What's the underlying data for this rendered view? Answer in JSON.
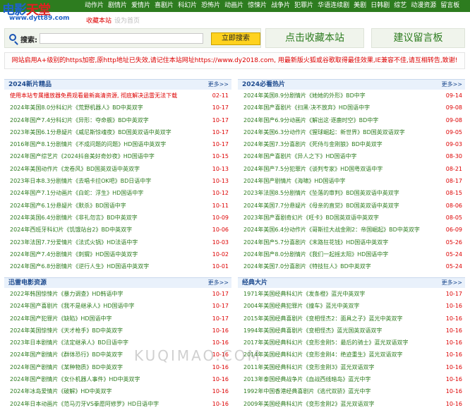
{
  "logo": {
    "main": "电影",
    "accent": "天堂",
    "domain": "www.dytt89.com"
  },
  "nav": [
    "动作片",
    "剧情片",
    "爱情片",
    "喜剧片",
    "科幻片",
    "恐怖片",
    "动画片",
    "惊悚片",
    "战争片",
    "犯罪片",
    "华语连续剧",
    "美剧",
    "日韩剧",
    "综艺",
    "动漫资源",
    "留言板"
  ],
  "subnav": {
    "favorite": "收藏本站",
    "home": "设为首页"
  },
  "search": {
    "label": "搜索:",
    "placeholder": "",
    "button": "立即搜索"
  },
  "buttons": {
    "bookmark": "点击收藏本站",
    "guestbook": "建议留言板"
  },
  "notice": "网站启用A+级别的https加密,原http地址已失效,请记住本站网址https://www.dy2018.com, 用最新版火狐或谷歌取得最佳效果,IE兼容不佳,请互相转告,致谢!",
  "panels": [
    {
      "title": "2024新片精品",
      "more": "更多>>",
      "rows": [
        {
          "name": "使用本站专属播放器免费观看最新高清资源, 彻底解决迅雷无法下载",
          "date": "02-11",
          "hot": true
        },
        {
          "name": "2024年美国8.0分科幻片《荒野机器人》BD中英双字",
          "date": "10-17"
        },
        {
          "name": "2024年国产7.4分科幻片《异形：夺命舰》BD中英双字",
          "date": "10-17"
        },
        {
          "name": "2023年美国6.1分悬疑片《威尼斯惊魂夜》BD国英双语中英双字",
          "date": "10-17"
        },
        {
          "name": "2016年国产8.1分剧情片《不成问题的问题》HD国语中英双字",
          "date": "10-17"
        },
        {
          "name": "2024年国产综艺片《2024抖音美好奇妙夜》HD国语中字",
          "date": "10-15"
        },
        {
          "name": "2024年美国动作片《龙卷风》BD国英双语中英双字",
          "date": "10-13"
        },
        {
          "name": "2023年日本8.3分剧情片《去唱卡拉OK吧》BD日语中字",
          "date": "10-13"
        },
        {
          "name": "2024年国产7.1分动画片《白蛇：浮生》HD国语中字",
          "date": "10-12"
        },
        {
          "name": "2024年国产6.1分悬疑片《默杀》BD国语中字",
          "date": "10-11"
        },
        {
          "name": "2024年英国6.4分剧情片《非礼勿言》BD中英双字",
          "date": "10-09"
        },
        {
          "name": "2024年西班牙科幻片《饥饿站台2》BD中英双字",
          "date": "10-06"
        },
        {
          "name": "2023年法国7.7分爱情片《法式火锅》HD法语中字",
          "date": "10-03"
        },
        {
          "name": "2024年国产7.4分剧情片《刺猬》HD国语中英双字",
          "date": "10-02"
        },
        {
          "name": "2024年国产6.8分剧情片《逆行人生》HD国语中英双字",
          "date": "10-01"
        }
      ]
    },
    {
      "title": "2024必看热片",
      "more": "更多>>",
      "rows": [
        {
          "name": "2024年美国8.9分剧情片《她她的外形》BD中字",
          "date": "09-14"
        },
        {
          "name": "2024年国产喜剧片《扫黑·决不放弃》HD国语中字",
          "date": "09-08"
        },
        {
          "name": "2024年国产6.9分动画片《解出这·逐鹿时空》BD中字",
          "date": "09-08"
        },
        {
          "name": "2024年美国6.3分动作片《猩球崛起：新世界》BD国英双语双字",
          "date": "09-05"
        },
        {
          "name": "2024年美国7.3分喜剧片《死侍与金刚狼》BD中英双字",
          "date": "09-03"
        },
        {
          "name": "2024年国产喜剧片《异人之下》HD国语中字",
          "date": "08-30"
        },
        {
          "name": "2024年国产7.5分犯罪片《谈判专家》HD国粤双语中字",
          "date": "08-21"
        },
        {
          "name": "2024年国产剧情片《海啸》HD国语中字",
          "date": "08-17"
        },
        {
          "name": "2023年法国8.5分剧情片《坠落的审判》BD国英双语中英双字",
          "date": "08-15"
        },
        {
          "name": "2024年美国7.7分悬疑片《母亲的直觉》BD国英双语中英双字",
          "date": "08-06"
        },
        {
          "name": "2023年国产喜剧奇幻片《旺卡》BD国英双语中英双字",
          "date": "08-05"
        },
        {
          "name": "2024年美国6.4分动作片《哥斯拉大战金刚2：帝国崛起》BD中英双字",
          "date": "06-09"
        },
        {
          "name": "2024年国产5.7分喜剧片《末路狂花钱》HD国语中英双字",
          "date": "05-26"
        },
        {
          "name": "2024年国产8.0分剧情片《我们一起摇太阳》HD国语中字",
          "date": "05-24"
        },
        {
          "name": "2024年美国7.0分喜剧片《特技狂人》BD中英双字",
          "date": "05-24"
        }
      ]
    },
    {
      "title": "迅雷电影资源",
      "more": "更多>>",
      "rows": [
        {
          "name": "2022年韩国惊悚片《暴力调查》HD韩语中字",
          "date": "10-17"
        },
        {
          "name": "2024年国产喜剧片《我不是继承人》HD国语中字",
          "date": "10-17"
        },
        {
          "name": "2024年国产犯罪片《缺陷》HD国语中字",
          "date": "10-17"
        },
        {
          "name": "2024年美国惊悚片《天才枪手》BD中英双字",
          "date": "10-16"
        },
        {
          "name": "2023年日本剧情片《法定继承人》BD日语中字",
          "date": "10-16"
        },
        {
          "name": "2024年国产剧情片《群体恐行》BD中英双字",
          "date": "10-16"
        },
        {
          "name": "2024年国产剧情片《某种物质》BD中英双字",
          "date": "10-16"
        },
        {
          "name": "2024年国产剧情片《女仆机器人事件》HD中英双字",
          "date": "10-16"
        },
        {
          "name": "2024年冰岛爱情片《破解》HD中英双字",
          "date": "10-16"
        },
        {
          "name": "2024年日本动画片《范马刃牙VS拳愿阿修罗》HD日语中字",
          "date": "10-16"
        }
      ]
    },
    {
      "title": "经典大片",
      "more": "更多>>",
      "rows": [
        {
          "name": "1971年美国经典科幻片《发条橙》蓝光中英双字",
          "date": "10-17"
        },
        {
          "name": "2004年美国经典犯罪片《撞车》蓝光中英双字",
          "date": "10-16"
        },
        {
          "name": "2015年美国经典喜剧片《变相怪杰2：面具之子》蓝光中英双字",
          "date": "10-16"
        },
        {
          "name": "1994年美国经典喜剧片《变相怪杰》蓝光国英双语双字",
          "date": "10-16"
        },
        {
          "name": "2017年美国经典科幻片《变形金刚5：最后的骑士》蓝光双语双字",
          "date": "10-16"
        },
        {
          "name": "2014年美国经典科幻片《变形金刚4：绝迹重生》蓝光双语双字",
          "date": "10-16"
        },
        {
          "name": "2011年美国经典科幻片《变形金刚3》蓝光双语双字",
          "date": "10-16"
        },
        {
          "name": "2013年泰国经典战争片《血战西线暗岛》蓝光中字",
          "date": "10-16"
        },
        {
          "name": "1992年中国香港经典喜剧片《逃代双骄》蓝光中字",
          "date": "10-16"
        },
        {
          "name": "2009年美国经典科幻片《变形金刚2》蓝光双语双字",
          "date": "10-16"
        }
      ]
    }
  ],
  "watermark": "KUQIMAO.COM"
}
